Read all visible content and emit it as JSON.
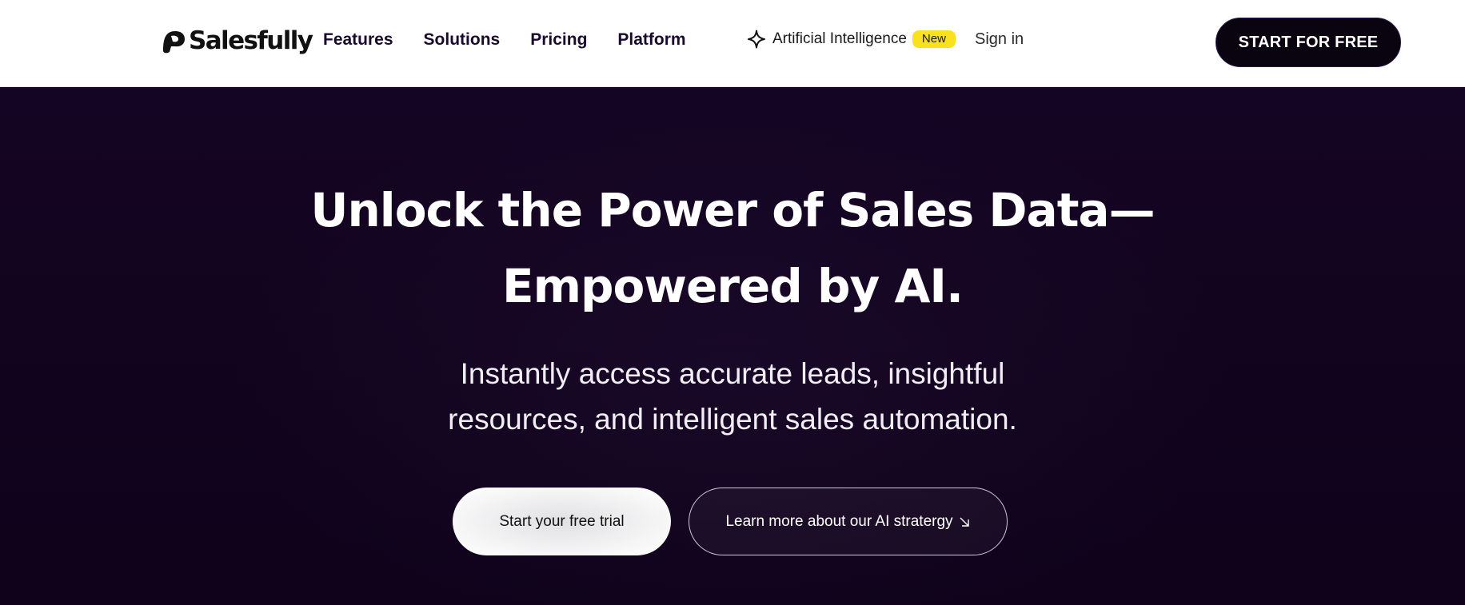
{
  "brand": {
    "name": "Salesfully"
  },
  "nav": {
    "links": [
      "Features",
      "Solutions",
      "Pricing",
      "Platform"
    ],
    "ai_label": "Artificial Intelligence",
    "ai_badge": "New",
    "signin": "Sign in",
    "cta": "START FOR FREE"
  },
  "hero": {
    "title_line1": "Unlock the Power of Sales Data—",
    "title_line2": "Empowered by AI.",
    "subtitle_line1": "Instantly access accurate leads, insightful",
    "subtitle_line2": "resources, and intelligent sales automation.",
    "primary_button": "Start your free trial",
    "secondary_button": "Learn more about our AI stratergy"
  },
  "icons": {
    "ai": "sparkle-icon",
    "secondary": "arrow-down-right-icon",
    "logo": "logo-mark-icon"
  },
  "colors": {
    "hero_background": "#12041f",
    "badge": "#f9e11e",
    "cta": "#0a0410"
  }
}
